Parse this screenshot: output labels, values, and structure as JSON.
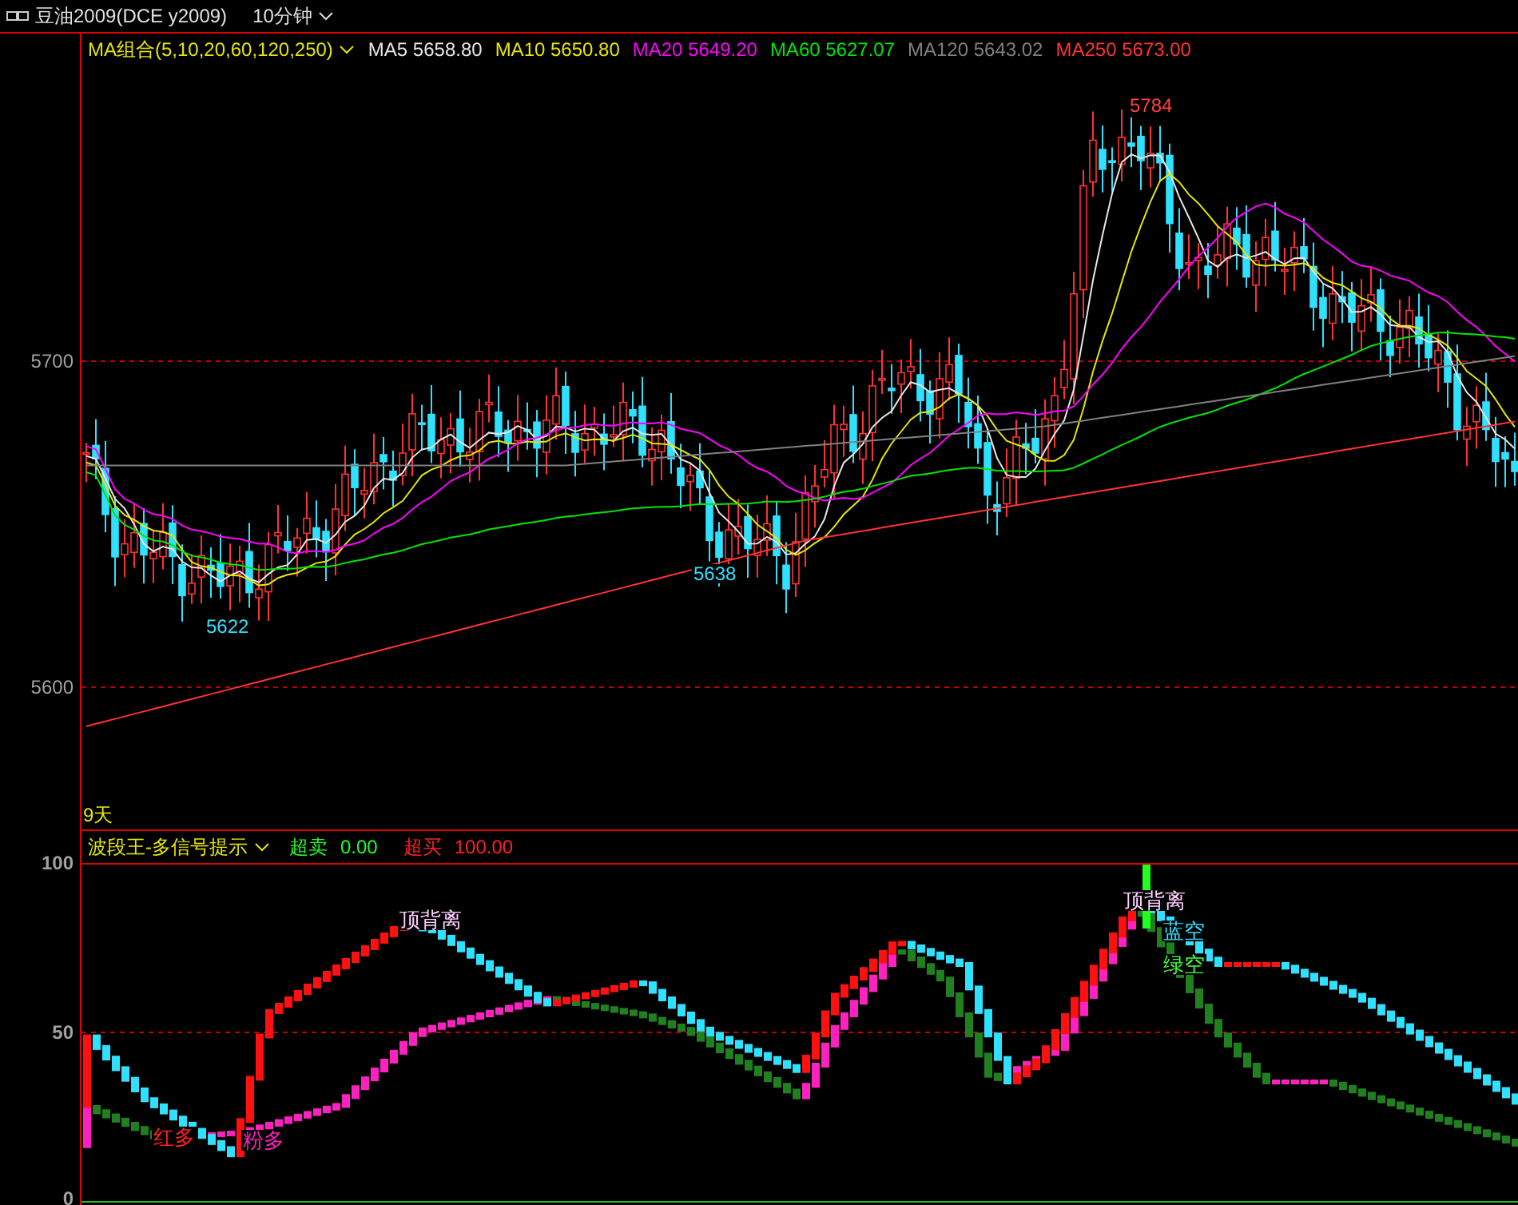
{
  "title_bar": {
    "symbol": "豆油2009(DCE y2009)",
    "period": "10分钟"
  },
  "main_chart": {
    "indicator": "MA组合(5,10,20,60,120,250)",
    "ma_legend": [
      {
        "label": "MA5 5658.80",
        "color": "#e6e6e6"
      },
      {
        "label": "MA10 5650.80",
        "color": "#e6e600"
      },
      {
        "label": "MA20 5649.20",
        "color": "#ff00ff"
      },
      {
        "label": "MA60 5627.07",
        "color": "#00e600"
      },
      {
        "label": "MA120 5643.02",
        "color": "#808080"
      },
      {
        "label": "MA250 5673.00",
        "color": "#ff3232"
      }
    ],
    "y_axis": [
      "5700",
      "5600"
    ],
    "price_marks": [
      {
        "text": "5784",
        "kind": "high"
      },
      {
        "text": "5622",
        "kind": "low"
      },
      {
        "text": "5638",
        "kind": "low"
      }
    ],
    "range_label": "9天"
  },
  "indicator_panel": {
    "name": "波段王-多信号提示",
    "oversold": {
      "label": "超卖",
      "value": "0.00"
    },
    "overbought": {
      "label": "超买",
      "value": "100.00"
    },
    "y_axis": [
      "100",
      "50",
      "0"
    ],
    "signals": [
      {
        "text": "顶背离",
        "kind": "top"
      },
      {
        "text": "顶背离",
        "kind": "top"
      },
      {
        "text": "红多",
        "kind": "red"
      },
      {
        "text": "粉多",
        "kind": "pink"
      },
      {
        "text": "蓝空",
        "kind": "blue"
      },
      {
        "text": "绿空",
        "kind": "green"
      }
    ]
  }
}
